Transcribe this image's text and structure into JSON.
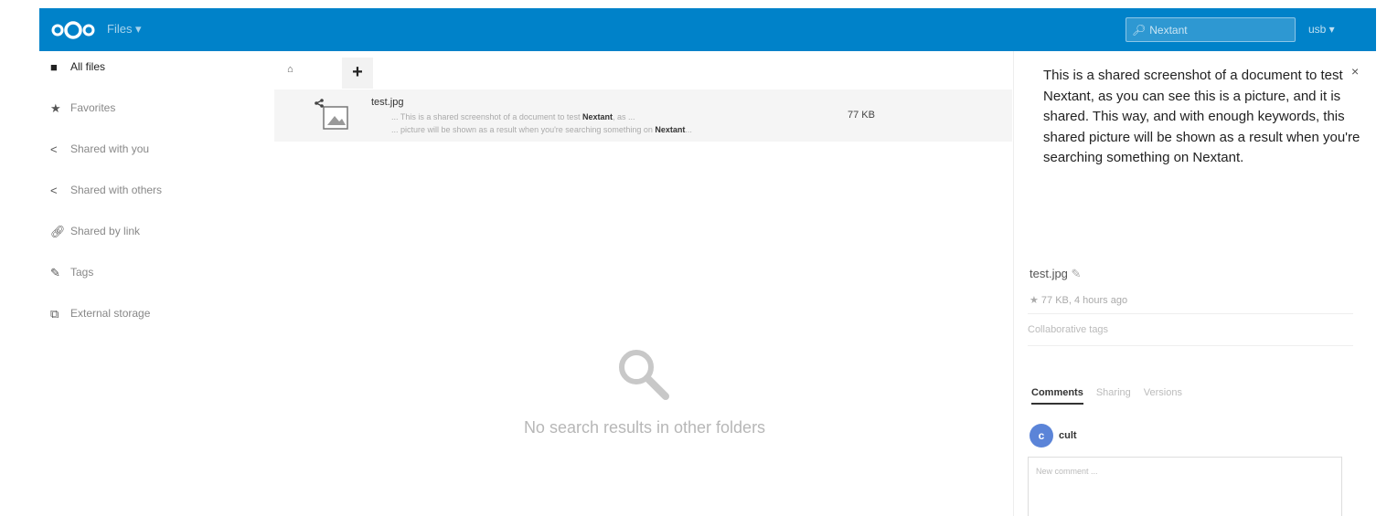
{
  "colors": {
    "accent": "#0082c9"
  },
  "header": {
    "app_menu": "Files ▾",
    "search": {
      "icon": "search-icon",
      "value": "Nextant"
    },
    "user_menu": "usb ▾"
  },
  "sidebar": {
    "items": [
      {
        "label": "All files",
        "icon": "folder-icon"
      },
      {
        "label": "Favorites",
        "icon": "star-icon"
      },
      {
        "label": "Shared with you",
        "icon": "share-icon"
      },
      {
        "label": "Shared with others",
        "icon": "share-icon"
      },
      {
        "label": "Shared by link",
        "icon": "link-icon"
      },
      {
        "label": "Tags",
        "icon": "tag-icon"
      },
      {
        "label": "External storage",
        "icon": "external-icon"
      }
    ]
  },
  "toolbar": {
    "add_label": "+"
  },
  "results": {
    "file": {
      "name": "test.jpg",
      "size": "77 KB",
      "excerpt_1_pre": "... This is a shared screenshot of a document to test ",
      "excerpt_1_match": "Nextant",
      "excerpt_1_post": ", as ...",
      "excerpt_2_pre": "... picture will be shown as a result when you're searching something on ",
      "excerpt_2_match": "Nextant",
      "excerpt_2_post": "..."
    },
    "empty_message": "No search results in other folders"
  },
  "details": {
    "description": "This is a shared screenshot of a document to test Nextant, as you can see this is a picture, and it is shared. This way, and with enough keywords, this shared picture will be shown as a result when you're searching something on Nextant.",
    "close": "×",
    "file_name": "test.jpg",
    "meta": "★ 77 KB, 4 hours ago",
    "tags_placeholder": "Collaborative tags",
    "tabs": [
      "Comments",
      "Sharing",
      "Versions"
    ],
    "comment_user": "cult",
    "comment_avatar_letter": "c",
    "comment_placeholder": "New comment ..."
  }
}
